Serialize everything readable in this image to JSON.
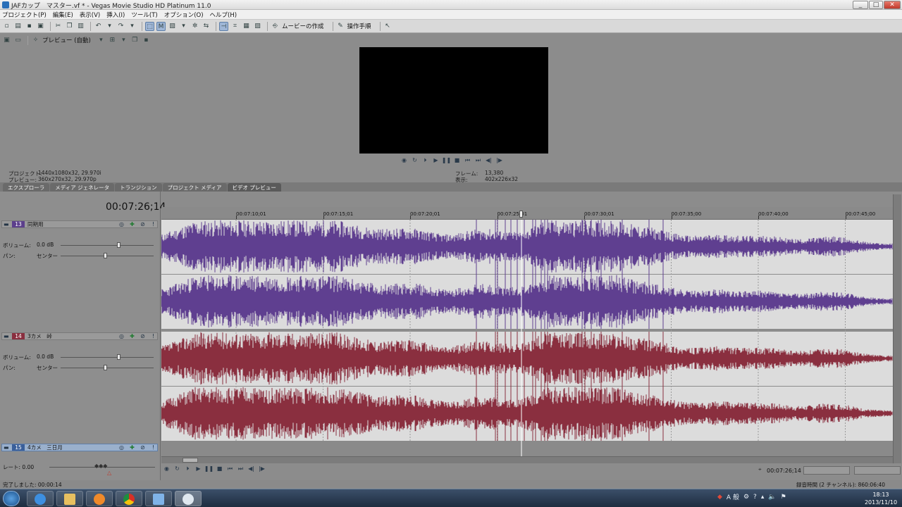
{
  "window": {
    "title": "JAFカップ　マスター.vf * - Vegas Movie Studio HD Platinum 11.0",
    "minimize": "_",
    "maximize": "□",
    "close": "✕"
  },
  "menu": [
    "プロジェクト(P)",
    "編集(E)",
    "表示(V)",
    "挿入(I)",
    "ツール(T)",
    "オプション(O)",
    "ヘルプ(H)"
  ],
  "toolbar": {
    "make_movie": "ムービーの作成",
    "guide": "操作手順"
  },
  "preview": {
    "mode": "プレビュー (自動)",
    "project_label": "プロジェクト:",
    "project_value": "1440x1080x32, 29.970i",
    "preview_label": "プレビュー:",
    "preview_value": "360x270x32, 29.970p",
    "frame_label": "フレーム:",
    "frame_value": "13,380",
    "display_label": "表示:",
    "display_value": "402x226x32"
  },
  "tabs": [
    "エクスプローラ",
    "メディア ジェネレータ",
    "トランジション",
    "プロジェクト メディア",
    "ビデオ プレビュー"
  ],
  "active_tab": 4,
  "timeline": {
    "timecode": "00:07:26;14",
    "ruler": [
      "00:07:10;01",
      "00:07:15;01",
      "00:07:20;01",
      "00:07:25;01",
      "00:07:30;01",
      "00:07:35;00",
      "00:07:40;00",
      "00:07:45;00"
    ],
    "tracks": [
      {
        "number": "13",
        "name": "同期用",
        "volume_label": "ボリューム:",
        "volume": "0.0 dB",
        "pan_label": "パン:",
        "pan": "センター",
        "color": "#5f3f90",
        "num_color": "#5c3f8c"
      },
      {
        "number": "14",
        "name": "3カメ　峠",
        "volume_label": "ボリューム:",
        "volume": "0.0 dB",
        "pan_label": "パン:",
        "pan": "センター",
        "color": "#8a2f3f",
        "num_color": "#8a2f3f"
      },
      {
        "number": "15",
        "name": "4カメ　三日月",
        "color": "#3a5f9a",
        "num_color": "#3a5f9a"
      }
    ],
    "rate_label": "レート: 0.00",
    "bottom_time": "00:07:26;14"
  },
  "status": {
    "left": "完了しました: 00:00:14",
    "rec_time": "録音時間 (2 チャンネル): 860:06:40"
  },
  "taskbar": {
    "ime": "A 般",
    "clock_time": "18:13",
    "clock_date": "2013/11/10"
  }
}
